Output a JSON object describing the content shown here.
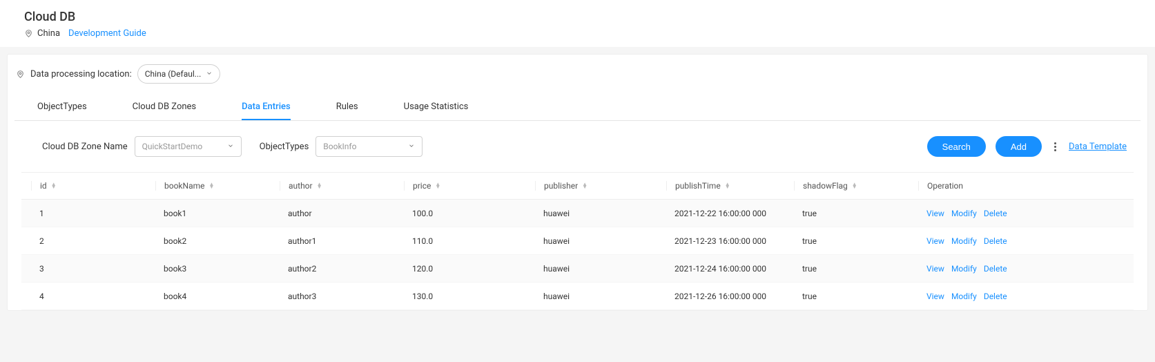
{
  "header": {
    "title": "Cloud DB",
    "country": "China",
    "dev_guide": "Development Guide"
  },
  "processing": {
    "label": "Data processing location:",
    "selected": "China (Defaul..."
  },
  "tabs": {
    "items": [
      {
        "label": "ObjectTypes",
        "active": false
      },
      {
        "label": "Cloud DB Zones",
        "active": false
      },
      {
        "label": "Data Entries",
        "active": true
      },
      {
        "label": "Rules",
        "active": false
      },
      {
        "label": "Usage Statistics",
        "active": false
      }
    ]
  },
  "filters": {
    "zone_label": "Cloud DB Zone Name",
    "zone_value": "QuickStartDemo",
    "ot_label": "ObjectTypes",
    "ot_value": "BookInfo"
  },
  "actions": {
    "search": "Search",
    "add": "Add",
    "template": "Data Template"
  },
  "table": {
    "columns": {
      "id": "id",
      "bookName": "bookName",
      "author": "author",
      "price": "price",
      "publisher": "publisher",
      "publishTime": "publishTime",
      "shadowFlag": "shadowFlag",
      "operation": "Operation"
    },
    "ops": {
      "view": "View",
      "modify": "Modify",
      "delete": "Delete"
    },
    "rows": [
      {
        "id": "1",
        "bookName": "book1",
        "author": "author",
        "price": "100.0",
        "publisher": "huawei",
        "publishTime": "2021-12-22 16:00:00 000",
        "shadowFlag": "true"
      },
      {
        "id": "2",
        "bookName": "book2",
        "author": "author1",
        "price": "110.0",
        "publisher": "huawei",
        "publishTime": "2021-12-23 16:00:00 000",
        "shadowFlag": "true"
      },
      {
        "id": "3",
        "bookName": "book3",
        "author": "author2",
        "price": "120.0",
        "publisher": "huawei",
        "publishTime": "2021-12-24 16:00:00 000",
        "shadowFlag": "true"
      },
      {
        "id": "4",
        "bookName": "book4",
        "author": "author3",
        "price": "130.0",
        "publisher": "huawei",
        "publishTime": "2021-12-26 16:00:00 000",
        "shadowFlag": "true"
      }
    ]
  }
}
